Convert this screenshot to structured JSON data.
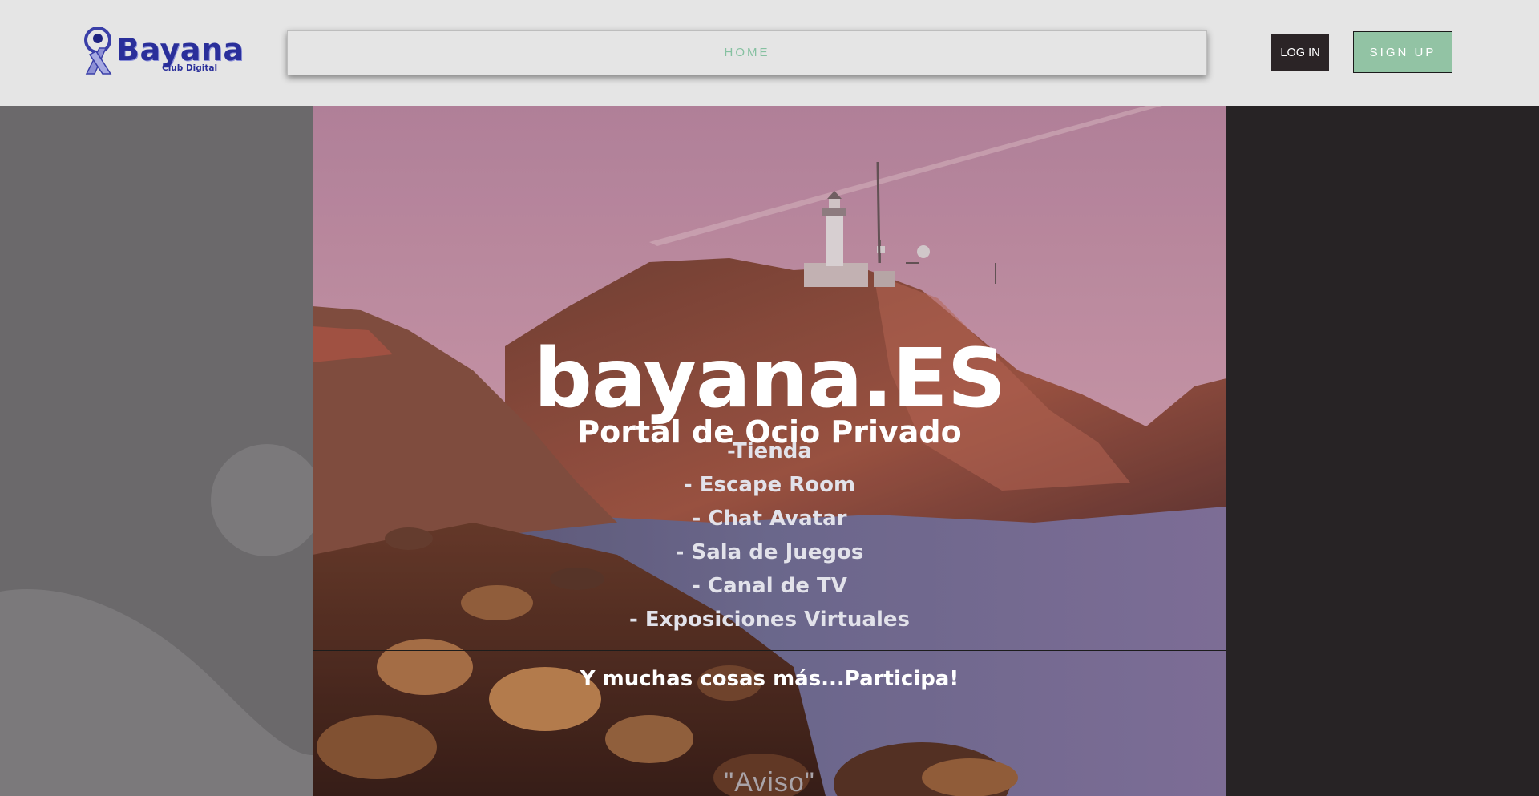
{
  "header": {
    "logo": {
      "word": "Bayana",
      "tagline": "Club Digital"
    },
    "nav": {
      "items": [
        {
          "label": "HOME"
        }
      ]
    },
    "login_label": "LOG IN",
    "signup_label": "SIGN UP"
  },
  "hero": {
    "title": "bayana.ES",
    "subtitle": "Portal de Ocio Privado",
    "features": [
      "-Tienda",
      "- Escape Room",
      "- Chat Avatar",
      "- Sala de Juegos",
      "- Canal de TV",
      "- Exposiciones Virtuales"
    ],
    "cta": "Y muchas cosas más...Participa!",
    "notice": "\"Aviso\""
  },
  "colors": {
    "header_bg": "#e5e5e5",
    "nav_text": "#86c1a1",
    "login_bg": "#2b2426",
    "signup_bg": "#92c3a4",
    "logo_blue": "#2a2f9a",
    "left_panel": "#6b696b",
    "right_panel": "#272325"
  },
  "icons": {
    "logo_mark": "person-figure-icon",
    "hero_image": "lighthouse-coast-photo"
  }
}
